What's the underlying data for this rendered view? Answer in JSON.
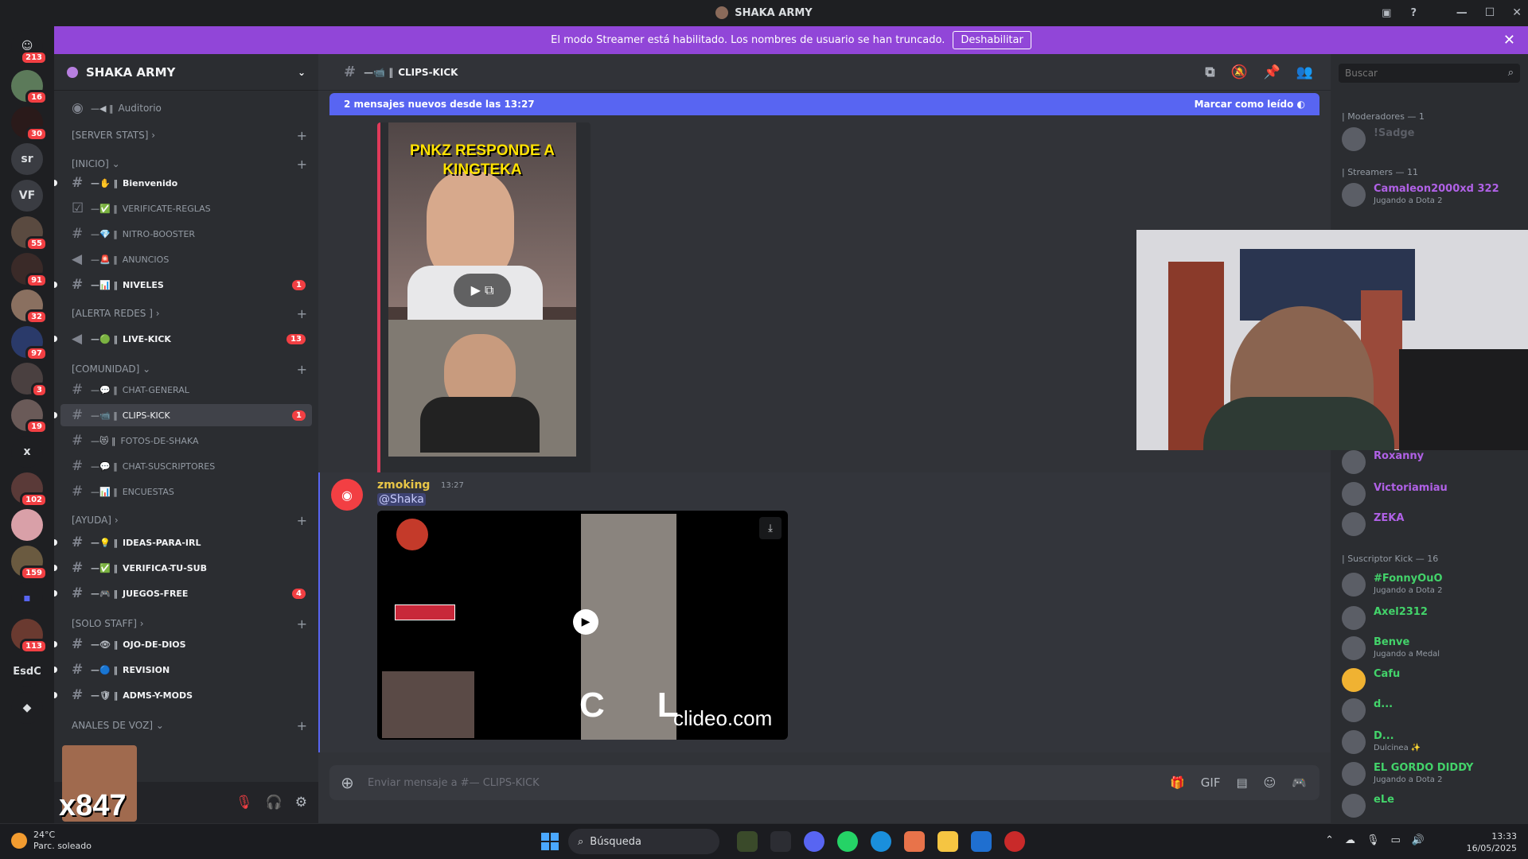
{
  "window": {
    "title": "SHAKA ARMY"
  },
  "banner": {
    "text": "El modo Streamer está habilitado. Los nombres de usuario se han truncado.",
    "button": "Deshabilitar"
  },
  "guilds": [
    {
      "label": "",
      "badge": "213"
    },
    {
      "label": "",
      "badge": "16"
    },
    {
      "label": "",
      "badge": "30"
    },
    {
      "label": "sr",
      "badge": ""
    },
    {
      "label": "VF",
      "badge": ""
    },
    {
      "label": "",
      "badge": "55"
    },
    {
      "label": "",
      "badge": "91"
    },
    {
      "label": "",
      "badge": "32"
    },
    {
      "label": "",
      "badge": "97"
    },
    {
      "label": "",
      "badge": "3"
    },
    {
      "label": "",
      "badge": "19"
    },
    {
      "label": "x",
      "badge": ""
    },
    {
      "label": "",
      "badge": "102"
    },
    {
      "label": "",
      "badge": ""
    },
    {
      "label": "",
      "badge": "159"
    },
    {
      "label": "",
      "badge": ""
    },
    {
      "label": "",
      "badge": "113"
    },
    {
      "label": "EsdC",
      "badge": ""
    },
    {
      "label": "",
      "badge": ""
    }
  ],
  "server": {
    "name": "SHAKA ARMY"
  },
  "sidebar": {
    "auditorio": "Auditorio",
    "cat_server_stats": "[SERVER STATS]",
    "cat_inicio": "[INICIO]",
    "ch_bienvenido": "Bienvenido",
    "ch_verificate": "VERIFICATE-REGLAS",
    "ch_nitro": "NITRO-BOOSTER",
    "ch_anuncios": "ANUNCIOS",
    "ch_niveles": "NIVELES",
    "badge_niveles": "1",
    "cat_alerta": "[ALERTA REDES ]",
    "ch_livekick": "LIVE-KICK",
    "badge_livekick": "13",
    "cat_comunidad": "[COMUNIDAD]",
    "ch_chatgeneral": "CHAT-GENERAL",
    "ch_clipskick": "CLIPS-KICK",
    "badge_clipskick": "1",
    "ch_fotos": "FOTOS-DE-SHAKA",
    "ch_chatsusc": "CHAT-SUSCRIPTORES",
    "ch_encuestas": "ENCUESTAS",
    "cat_ayuda": "[AYUDA]",
    "ch_ideas": "IDEAS-PARA-IRL",
    "ch_verifica": "VERIFICA-TU-SUB",
    "ch_juegos": "JUEGOS-FREE",
    "badge_juegos": "4",
    "cat_staff": "[SOLO STAFF]",
    "ch_ojo": "OJO-DE-DIOS",
    "ch_revision": "REVISION",
    "ch_adms": "ADMS-Y-MODS",
    "cat_voz": "ANALES DE VOZ]",
    "user_overlay": "x847"
  },
  "chat": {
    "channel": "CLIPS-KICK",
    "new_messages": "2 mensajes nuevos desde las 13:27",
    "mark_read": "Marcar como leído",
    "thumb_title": "PNKZ RESPONDE A KINGTEKA",
    "message": {
      "author": "zmoking",
      "time": "13:27",
      "text": "@Shaka"
    },
    "video_watermark": "clideo.com",
    "video_letters": "CL",
    "composer_placeholder": "Enviar mensaje a #—  CLIPS-KICK"
  },
  "members": {
    "search_placeholder": "Buscar",
    "roles": [
      {
        "label": "| Moderadores — 1"
      },
      {
        "label": "| Streamers — 11"
      },
      {
        "label": "| Suscriptor Kick — 16"
      }
    ],
    "list": [
      {
        "name": "!Sadge",
        "activity": "",
        "color": "#5b5e66"
      },
      {
        "name": "Camaleon2000xd 322",
        "activity": "Jugando a Dota 2",
        "color": "#b061e6"
      },
      {
        "name": "Roxanny",
        "activity": "",
        "color": "#b061e6"
      },
      {
        "name": "Victoriamiau",
        "activity": "",
        "color": "#b061e6"
      },
      {
        "name": "ZEKA",
        "activity": "",
        "color": "#b061e6"
      },
      {
        "name": "#FonnyOuO",
        "activity": "Jugando a Dota 2",
        "color": "#43d36a"
      },
      {
        "name": "Axel2312",
        "activity": "",
        "color": "#43d36a"
      },
      {
        "name": "Benve",
        "activity": "Jugando a Medal",
        "color": "#43d36a"
      },
      {
        "name": "Cafu",
        "activity": "",
        "color": "#43d36a"
      },
      {
        "name": "d...",
        "activity": "",
        "color": "#43d36a"
      },
      {
        "name": "D...",
        "activity": "Dulcinea ✨",
        "color": "#43d36a"
      },
      {
        "name": "EL GORDO DIDDY",
        "activity": "Jugando a Dota 2",
        "color": "#43d36a"
      },
      {
        "name": "eLe",
        "activity": "",
        "color": "#43d36a"
      }
    ]
  },
  "taskbar": {
    "temp": "24°C",
    "weather": "Parc. soleado",
    "search": "Búsqueda",
    "time": "13:33",
    "date": "16/05/2025"
  }
}
